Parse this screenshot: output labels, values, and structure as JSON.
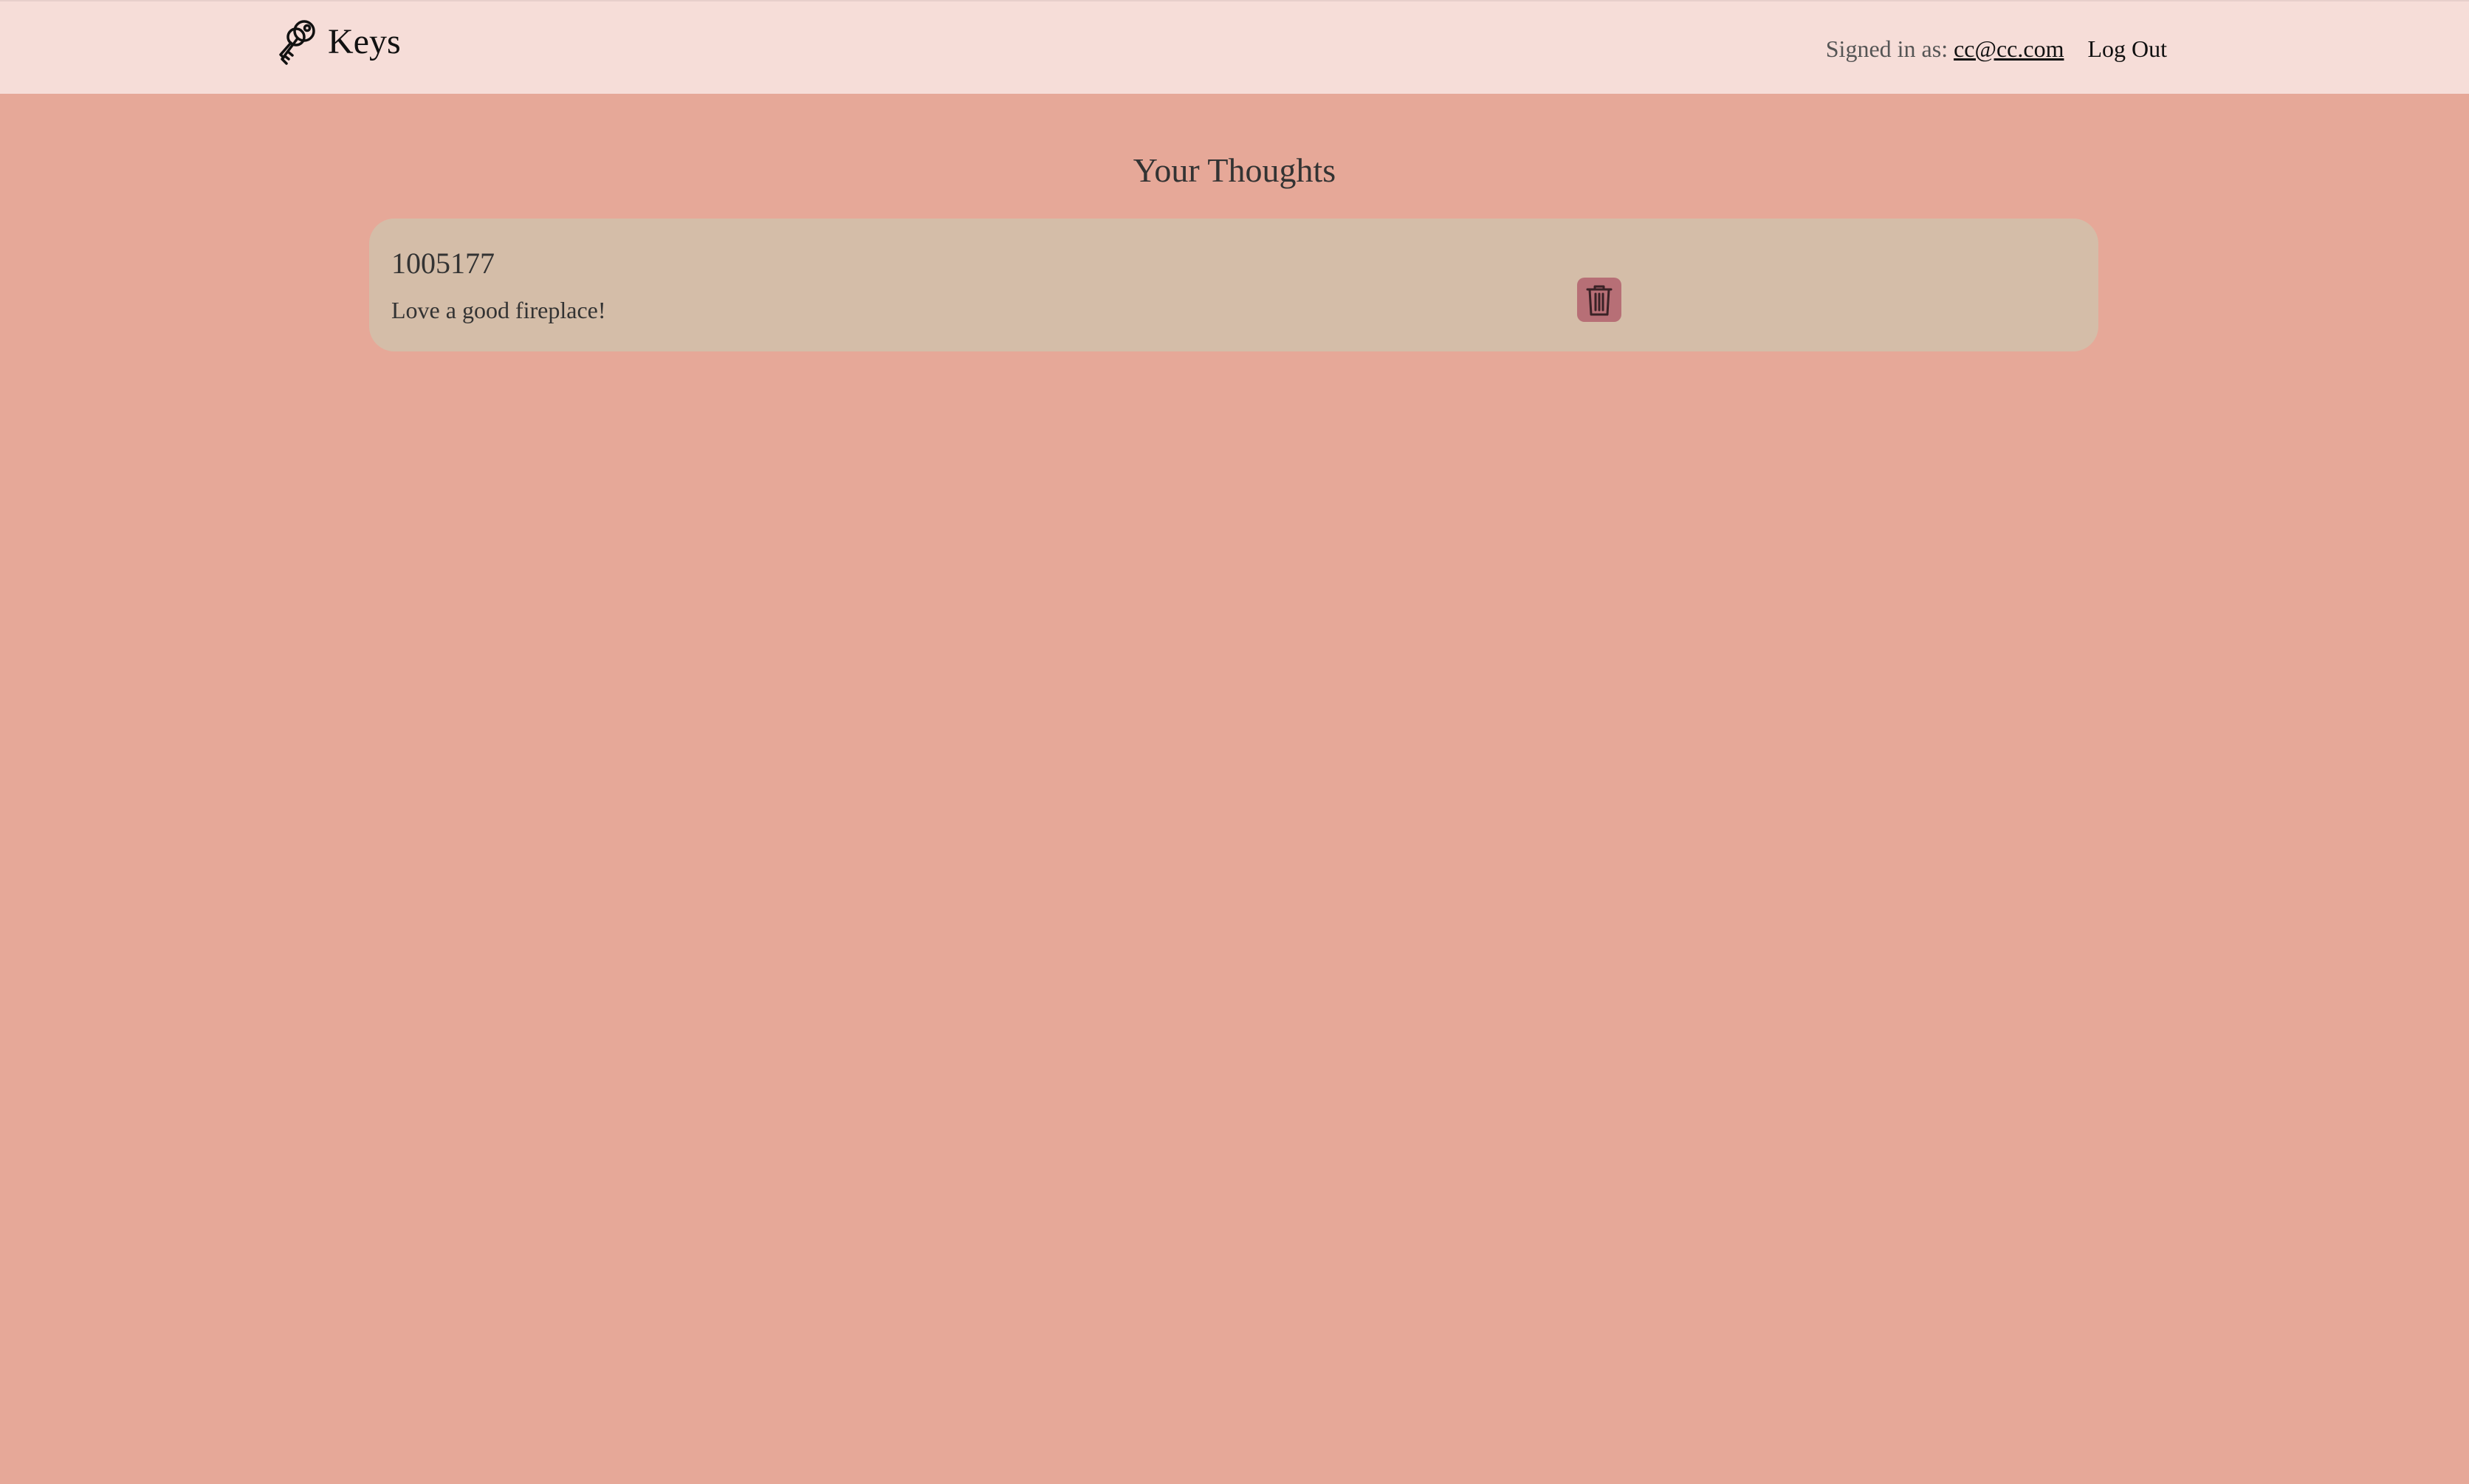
{
  "navbar": {
    "brand": {
      "name": "Keys",
      "icon": "keys-icon"
    },
    "signed_in_label": "Signed in as:",
    "user_email": "cc@cc.com",
    "logout_label": "Log Out"
  },
  "main": {
    "title": "Your Thoughts",
    "thoughts": [
      {
        "id": "1005177",
        "text": "Love a good fireplace!",
        "delete_icon": "trash-icon"
      }
    ]
  },
  "colors": {
    "background": "#e6a898",
    "navbar": "#f6ddd8",
    "card": "#d4bda8",
    "delete_button": "#b76f76"
  }
}
